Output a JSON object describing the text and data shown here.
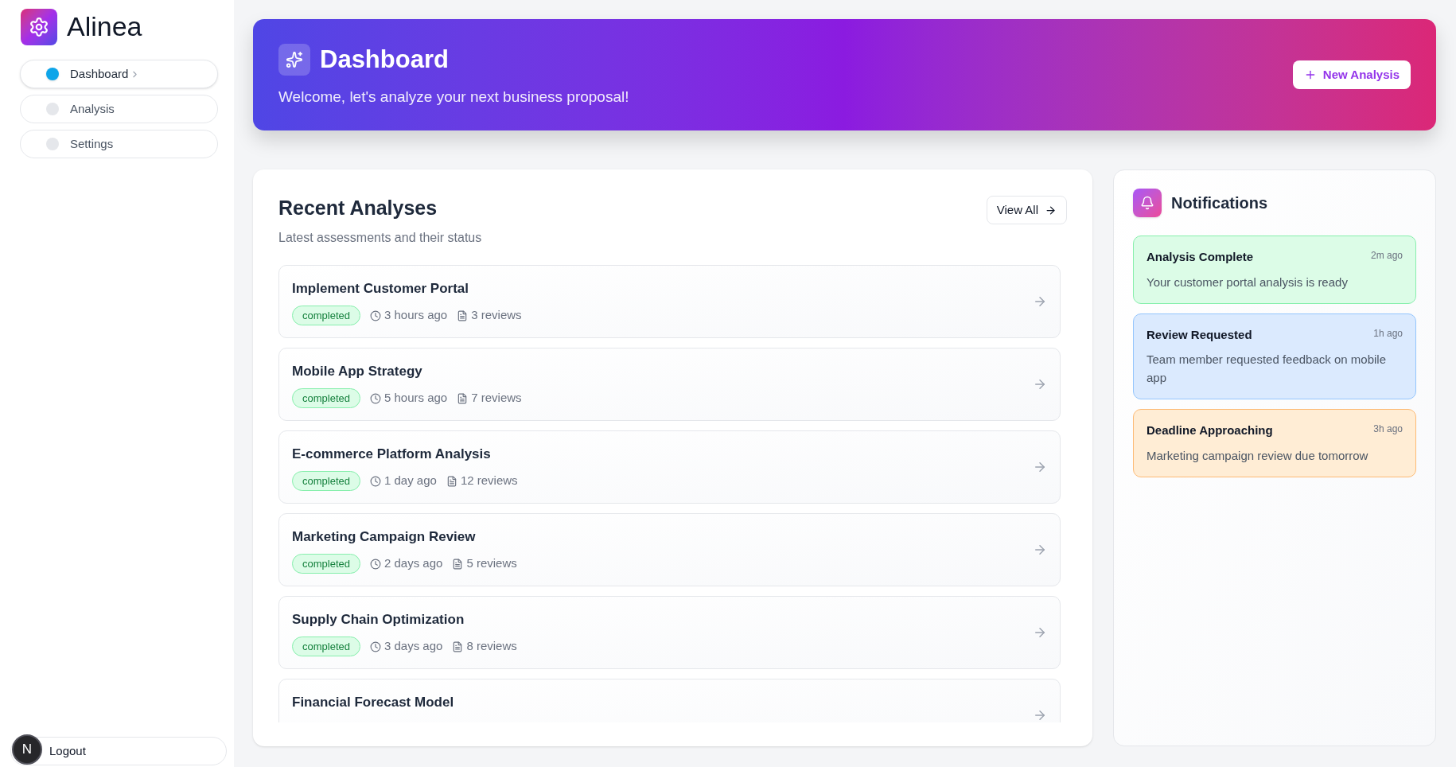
{
  "sidebar": {
    "brand": "Alinea",
    "items": [
      {
        "label": "Dashboard",
        "selected": true
      },
      {
        "label": "Analysis",
        "selected": false
      },
      {
        "label": "Settings",
        "selected": false
      }
    ],
    "logout": "Logout",
    "dev_badge": "N"
  },
  "header": {
    "title": "Dashboard",
    "subtitle": "Welcome, let's analyze your next business proposal!",
    "action": "New Analysis"
  },
  "recent": {
    "title": "Recent Analyses",
    "subtitle": "Latest assessments and their status",
    "view_all": "View All",
    "items": [
      {
        "title": "Implement Customer Portal",
        "status": "completed",
        "time": "3 hours ago",
        "reviews": "3 reviews"
      },
      {
        "title": "Mobile App Strategy",
        "status": "completed",
        "time": "5 hours ago",
        "reviews": "7 reviews"
      },
      {
        "title": "E-commerce Platform Analysis",
        "status": "completed",
        "time": "1 day ago",
        "reviews": "12 reviews"
      },
      {
        "title": "Marketing Campaign Review",
        "status": "completed",
        "time": "2 days ago",
        "reviews": "5 reviews"
      },
      {
        "title": "Supply Chain Optimization",
        "status": "completed",
        "time": "3 days ago",
        "reviews": "8 reviews"
      },
      {
        "title": "Financial Forecast Model"
      }
    ]
  },
  "notifications": {
    "title": "Notifications",
    "items": [
      {
        "kind": "success",
        "title": "Analysis Complete",
        "time": "2m ago",
        "message": "Your customer portal analysis is ready"
      },
      {
        "kind": "info",
        "title": "Review Requested",
        "time": "1h ago",
        "message": "Team member requested feedback on mobile app"
      },
      {
        "kind": "warning",
        "title": "Deadline Approaching",
        "time": "3h ago",
        "message": "Marketing campaign review due tomorrow"
      }
    ]
  }
}
